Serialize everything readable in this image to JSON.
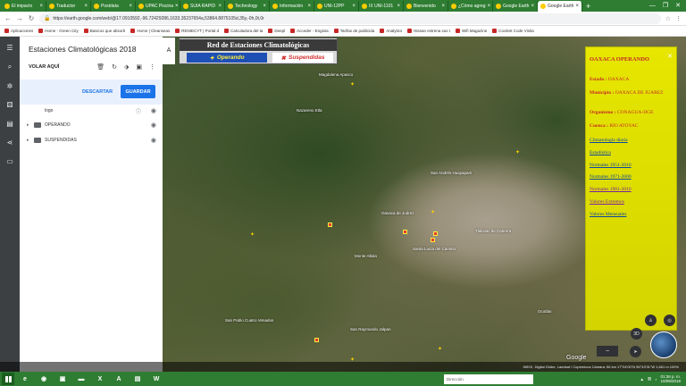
{
  "browser": {
    "tabs": [
      "El impacto",
      "Traductor",
      "Postdata",
      "UPAC Piscina",
      "SUIA RAPID",
      "Technology",
      "Información",
      "UNI-12PP",
      "IX UNI-1101",
      "Bienvenido",
      "¿Cómo agreg",
      "Google Earth",
      "Google Earth"
    ],
    "url": "https://earth.google.com/web/@17.0910592,-96.72429286,1633.35237654a,53864.8875105d,35y,-0h,0t,0r",
    "bookmarks": [
      "Aplicaciones",
      "Home - Green City",
      "Basicos que absorb",
      "Home | Cleanseas",
      "RENIECYT | Portal d",
      "Calculadora del ta",
      "Deepl",
      "Acceder - Enginia",
      "Tarifas de publicida",
      "Analytics",
      "Nissan estrena sus t",
      "Wifi Magazine",
      "Coolest Code Visita"
    ]
  },
  "panel": {
    "title": "Estaciones Climatológicas 2018",
    "fly_here": "VOLAR AQUÍ",
    "discard": "DESCARTAR",
    "save": "GUARDAR",
    "layers": [
      "logo",
      "OPERANDO",
      "SUSPENDIDAS"
    ]
  },
  "legend": {
    "title": "Red de Estaciones Climatológicas",
    "operating": "Operando",
    "suspended": "Suspendidas",
    "cut_letter": "A"
  },
  "balloon": {
    "title": "OAXACA    OPERANDO",
    "estado_key": "Estado :",
    "estado_val": "OAXACA",
    "municipio_key": "Municipio :",
    "municipio_val": "OAXACA DE JUAREZ",
    "organismo_key": "Organismo :",
    "organismo_val": "CONAGUA-DGE",
    "cuenca_key": "Cuenca :",
    "cuenca_val": "RIO ATOYAC",
    "links": [
      "Climatología diaria",
      "Estadística",
      "Normales 1951-2010",
      "Normales 1971-2000",
      "Normales 1981-2010",
      "Valores Extremos",
      "Valores Mensuales"
    ]
  },
  "map": {
    "labels": [
      "Magdalena Apasco",
      "Nazareno Etla",
      "San Andrés Huayapam",
      "Tlalixtac de Cabrera",
      "Santa Lucía del Camino",
      "Monte Albán",
      "Oaxaca de Juárez",
      "San Raymundo Jalpan",
      "San Pablo Cuatro Venados",
      "Ocotlán"
    ],
    "google": "Google",
    "status": "INEGI, Digital Globe, Landsat / Copernicus   Cámara: 56 km   17°04'00\"N 96°43'31\"W   1,661 m   100%",
    "three_d": "3D"
  },
  "taskbar": {
    "search_placeholder": "Dirección",
    "time": "01:36 p. m.",
    "date": "10/09/2018"
  },
  "colors": {
    "chrome_green": "#2e7d32",
    "balloon_yellow": "#e6e600",
    "accent_blue": "#1a73e8"
  }
}
